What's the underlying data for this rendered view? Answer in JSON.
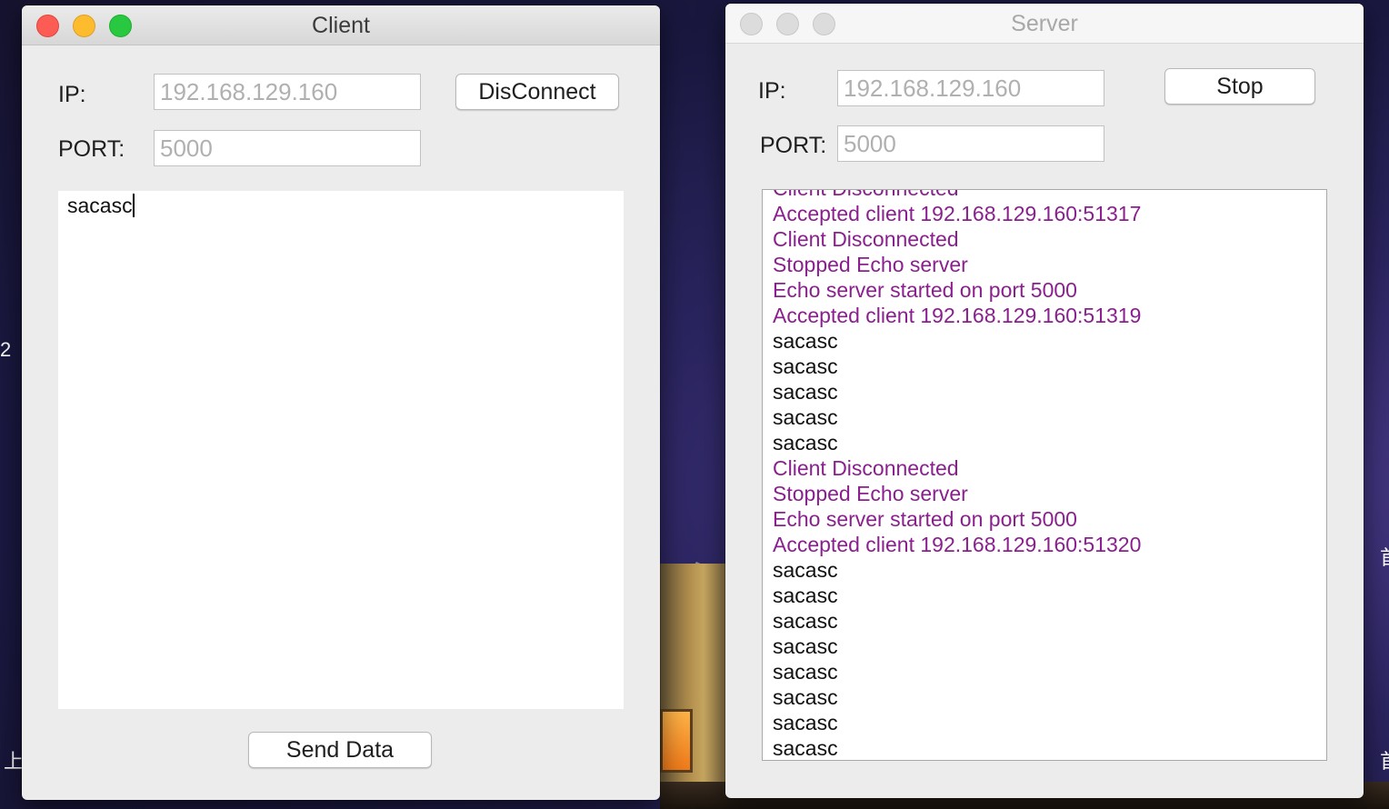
{
  "client": {
    "title": "Client",
    "ip_label": "IP:",
    "ip_value": "192.168.129.160",
    "port_label": "PORT:",
    "port_value": "5000",
    "connect_button": "DisConnect",
    "message_text": "sacasc",
    "send_button": "Send Data"
  },
  "server": {
    "title": "Server",
    "ip_label": "IP:",
    "ip_value": "192.168.129.160",
    "port_label": "PORT:",
    "port_value": "5000",
    "stop_button": "Stop",
    "log": [
      {
        "text": "Client Disconnected",
        "kind": "status"
      },
      {
        "text": "Accepted client 192.168.129.160:51317",
        "kind": "status"
      },
      {
        "text": "Client Disconnected",
        "kind": "status"
      },
      {
        "text": "Stopped Echo server",
        "kind": "status"
      },
      {
        "text": "Echo server started on port 5000",
        "kind": "status"
      },
      {
        "text": "Accepted client 192.168.129.160:51319",
        "kind": "status"
      },
      {
        "text": "sacasc",
        "kind": "data"
      },
      {
        "text": "sacasc",
        "kind": "data"
      },
      {
        "text": "sacasc",
        "kind": "data"
      },
      {
        "text": "sacasc",
        "kind": "data"
      },
      {
        "text": "sacasc",
        "kind": "data"
      },
      {
        "text": "Client Disconnected",
        "kind": "status"
      },
      {
        "text": "Stopped Echo server",
        "kind": "status"
      },
      {
        "text": "Echo server started on port 5000",
        "kind": "status"
      },
      {
        "text": "Accepted client 192.168.129.160:51320",
        "kind": "status"
      },
      {
        "text": "sacasc",
        "kind": "data"
      },
      {
        "text": "sacasc",
        "kind": "data"
      },
      {
        "text": "sacasc",
        "kind": "data"
      },
      {
        "text": "sacasc",
        "kind": "data"
      },
      {
        "text": "sacasc",
        "kind": "data"
      },
      {
        "text": "sacasc",
        "kind": "data"
      },
      {
        "text": "sacasc",
        "kind": "data"
      },
      {
        "text": "sacasc",
        "kind": "data"
      }
    ]
  },
  "desktop": {
    "left_glyph_mid": "2",
    "left_glyph_bottom": "上",
    "right_glyph": "首"
  },
  "colors": {
    "status_text": "#8a1f8e",
    "close": "#fd5c55",
    "minimize": "#fdbb2e",
    "zoom": "#28c840"
  }
}
